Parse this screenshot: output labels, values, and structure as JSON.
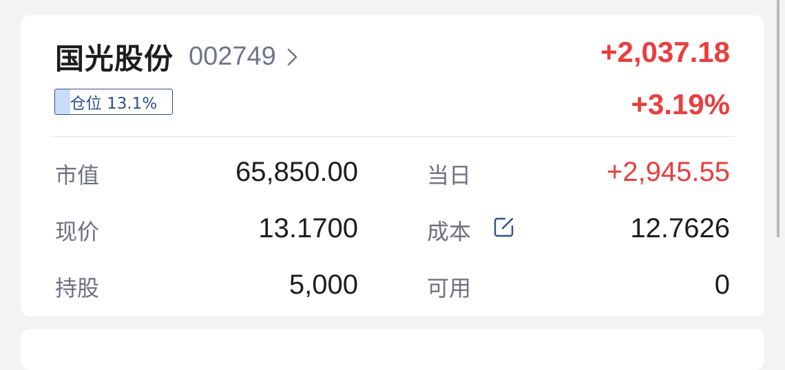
{
  "stock": {
    "name": "国光股份",
    "code": "002749",
    "pnl_amount": "+2,037.18",
    "pnl_percent": "+3.19%",
    "position_label": "仓位 13.1%",
    "position_fraction": 0.131
  },
  "details": {
    "market_value_label": "市值",
    "market_value": "65,850.00",
    "today_label": "当日",
    "today_value": "+2,945.55",
    "price_label": "现价",
    "price_value": "13.1700",
    "cost_label": "成本",
    "cost_value": "12.7626",
    "holdings_label": "持股",
    "holdings_value": "5,000",
    "available_label": "可用",
    "available_value": "0"
  },
  "colors": {
    "up": "#eb3d3d",
    "accent": "#2b4f8e",
    "badge_fill": "#c9dcfb"
  },
  "icons": {
    "code_arrow": "chevron-right-icon",
    "cost_edit": "edit-icon"
  }
}
